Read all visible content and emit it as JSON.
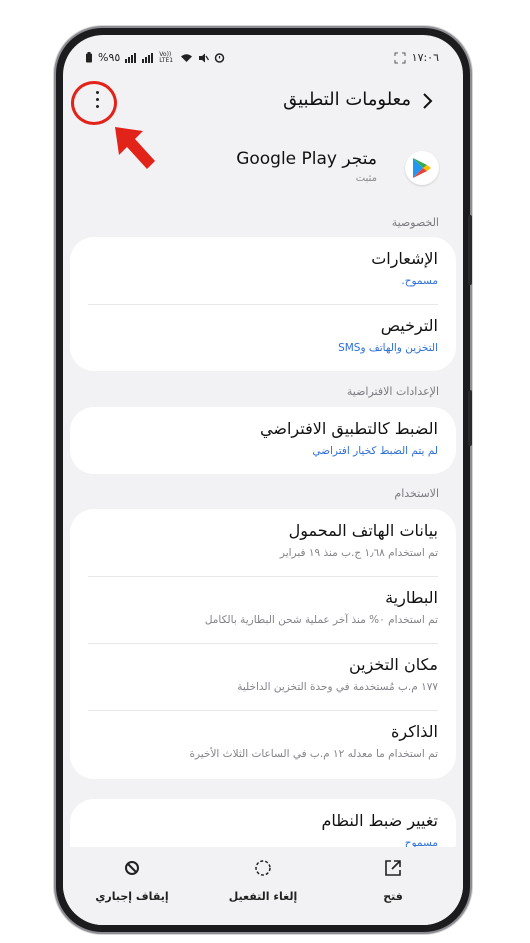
{
  "status_bar": {
    "battery_text": "%٩٥",
    "time": "١٧:٠٦",
    "network_label": "Vo)) LTE1"
  },
  "app_bar": {
    "title": "معلومات التطبيق"
  },
  "app": {
    "name": "متجر Google Play",
    "status": "مثبت"
  },
  "sections": {
    "privacy": "الخصوصية",
    "defaults": "الإعدادات الافتراضية",
    "usage": "الاستخدام"
  },
  "privacy_items": [
    {
      "title": "الإشعارات",
      "subtitle": "مسموح."
    },
    {
      "title": "الترخيص",
      "subtitle": "التخزين والهاتف وSMS"
    }
  ],
  "default_items": [
    {
      "title": "الضبط كالتطبيق الافتراضي",
      "subtitle": "لم يتم الضبط كخيار افتراضي"
    }
  ],
  "usage_items": [
    {
      "title": "بيانات الهاتف المحمول",
      "subtitle": "تم استخدام ١٫٦٨ ج.ب منذ ١٩ فبراير"
    },
    {
      "title": "البطارية",
      "subtitle": "تم استخدام ٠% منذ آخر عملية شحن البطارية بالكامل"
    },
    {
      "title": "مكان التخزين",
      "subtitle": "١٧٧ م.ب مُستخدمة في وحدة التخزين الداخلية"
    },
    {
      "title": "الذاكرة",
      "subtitle": "تم استخدام ما معدله ١٢ م.ب في الساعات الثلاث الأخيرة"
    }
  ],
  "system_items": [
    {
      "title": "تغيير ضبط النظام",
      "subtitle": "مسموح"
    }
  ],
  "bottom_bar": {
    "force_stop": "إيقاف إجباري",
    "disable": "إلغاء التفعيل",
    "open": "فتح"
  },
  "colors": {
    "accent_blue": "#2e6fd8",
    "highlight_red": "#e2231a",
    "background": "#f2f2f4"
  }
}
